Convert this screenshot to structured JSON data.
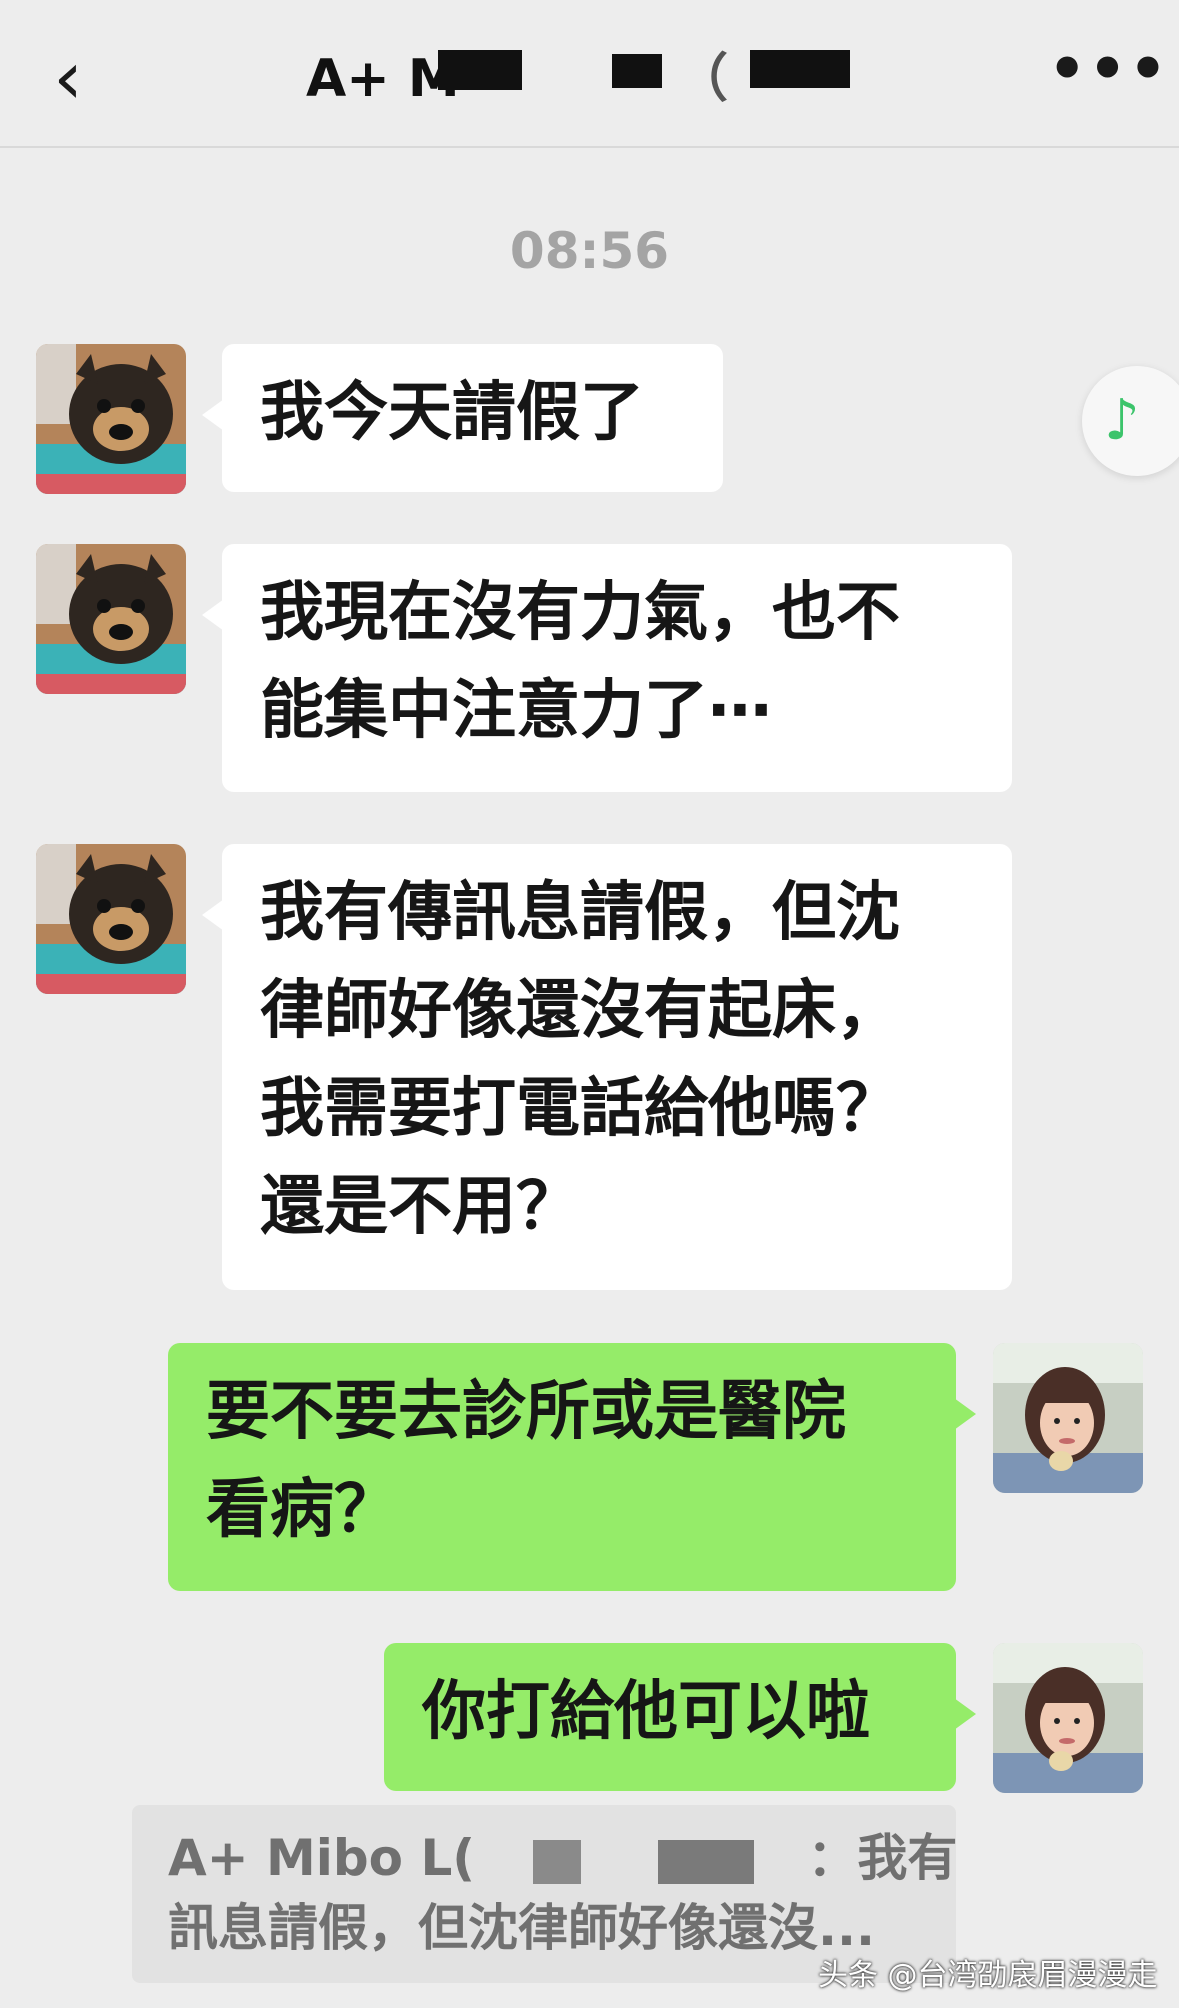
{
  "header": {
    "back_icon": "chevron-left-icon",
    "back_glyph": "‹",
    "title": "A+ M",
    "title_tail": "（",
    "more_glyph": "•••",
    "more_icon": "more-dots-icon"
  },
  "chat": {
    "timestamp": "08:56",
    "messages": [
      {
        "side": "in",
        "text": "我今天請假了"
      },
      {
        "side": "in",
        "text": "我現在沒有力氣，也不\n能集中注意力了⋯"
      },
      {
        "side": "in",
        "text": "我有傳訊息請假，但沈\n律師好像還沒有起床，\n我需要打電話給他嗎？\n還是不用？"
      },
      {
        "side": "out",
        "text": "要不要去診所或是醫院\n看病？"
      },
      {
        "side": "out",
        "text": "你打給他可以啦"
      }
    ]
  },
  "floating": {
    "music_glyph": "♪",
    "music_icon": "music-note-icon"
  },
  "quote": {
    "sender": "A+ Mibo L(",
    "sender_suffix": "：我有傳",
    "text": "訊息請假，但沈律師好像還沒..."
  },
  "watermark": "头条 @台湾劭扆眉漫漫走",
  "colors": {
    "background": "#ededed",
    "incoming_bubble": "#ffffff",
    "outgoing_bubble": "#95ec69",
    "music_accent": "#3cc46b"
  }
}
